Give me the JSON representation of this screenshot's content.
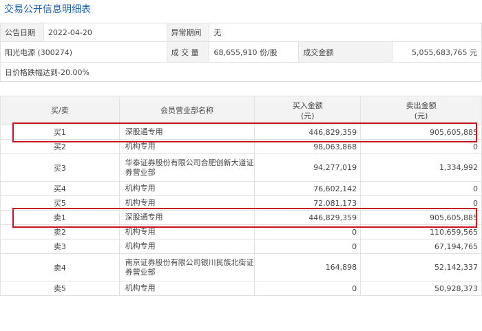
{
  "header": {
    "title": "交易公开信息明细表"
  },
  "info": {
    "date_label": "公告日期",
    "date_value": "2022-04-20",
    "period_label": "异常期间",
    "period_value": "无",
    "stock": "阳光电源 (300274)",
    "volume_label": "成 交 量",
    "volume_value": "68,655,910 份/股",
    "amount_label": "成交金额",
    "amount_value": "5,055,683,765 元",
    "reason": "日价格跌幅达到-20.00%"
  },
  "table": {
    "headers": [
      "买/卖",
      "会员营业部名称",
      "买入金额\n(元)",
      "卖出金额\n(元)"
    ],
    "rows": [
      {
        "side": "买1",
        "name": "深股通专用",
        "buy": "446,829,359",
        "sell": "905,605,885",
        "highlight": true
      },
      {
        "side": "买2",
        "name": "机构专用",
        "buy": "98,063,868",
        "sell": "0"
      },
      {
        "side": "买3",
        "name": "华泰证券股份有限公司合肥创新大道证券营业部",
        "buy": "94,277,019",
        "sell": "1,334,992"
      },
      {
        "side": "买4",
        "name": "机构专用",
        "buy": "76,602,142",
        "sell": "0"
      },
      {
        "side": "买5",
        "name": "机构专用",
        "buy": "72,081,173",
        "sell": "0"
      },
      {
        "side": "卖1",
        "name": "深股通专用",
        "buy": "446,829,359",
        "sell": "905,605,885",
        "highlight": true
      },
      {
        "side": "卖2",
        "name": "机构专用",
        "buy": "0",
        "sell": "110,659,565"
      },
      {
        "side": "卖3",
        "name": "机构专用",
        "buy": "0",
        "sell": "67,194,765"
      },
      {
        "side": "卖4",
        "name": "南京证券股份有限公司银川民族北街证券营业部",
        "buy": "164,898",
        "sell": "52,142,337"
      },
      {
        "side": "卖5",
        "name": "机构专用",
        "buy": "0",
        "sell": "50,928,373"
      }
    ]
  },
  "colors": {
    "title": "#1a5fa8",
    "highlight_border": "#c8141e",
    "label_bg": "#f3f3f3"
  }
}
